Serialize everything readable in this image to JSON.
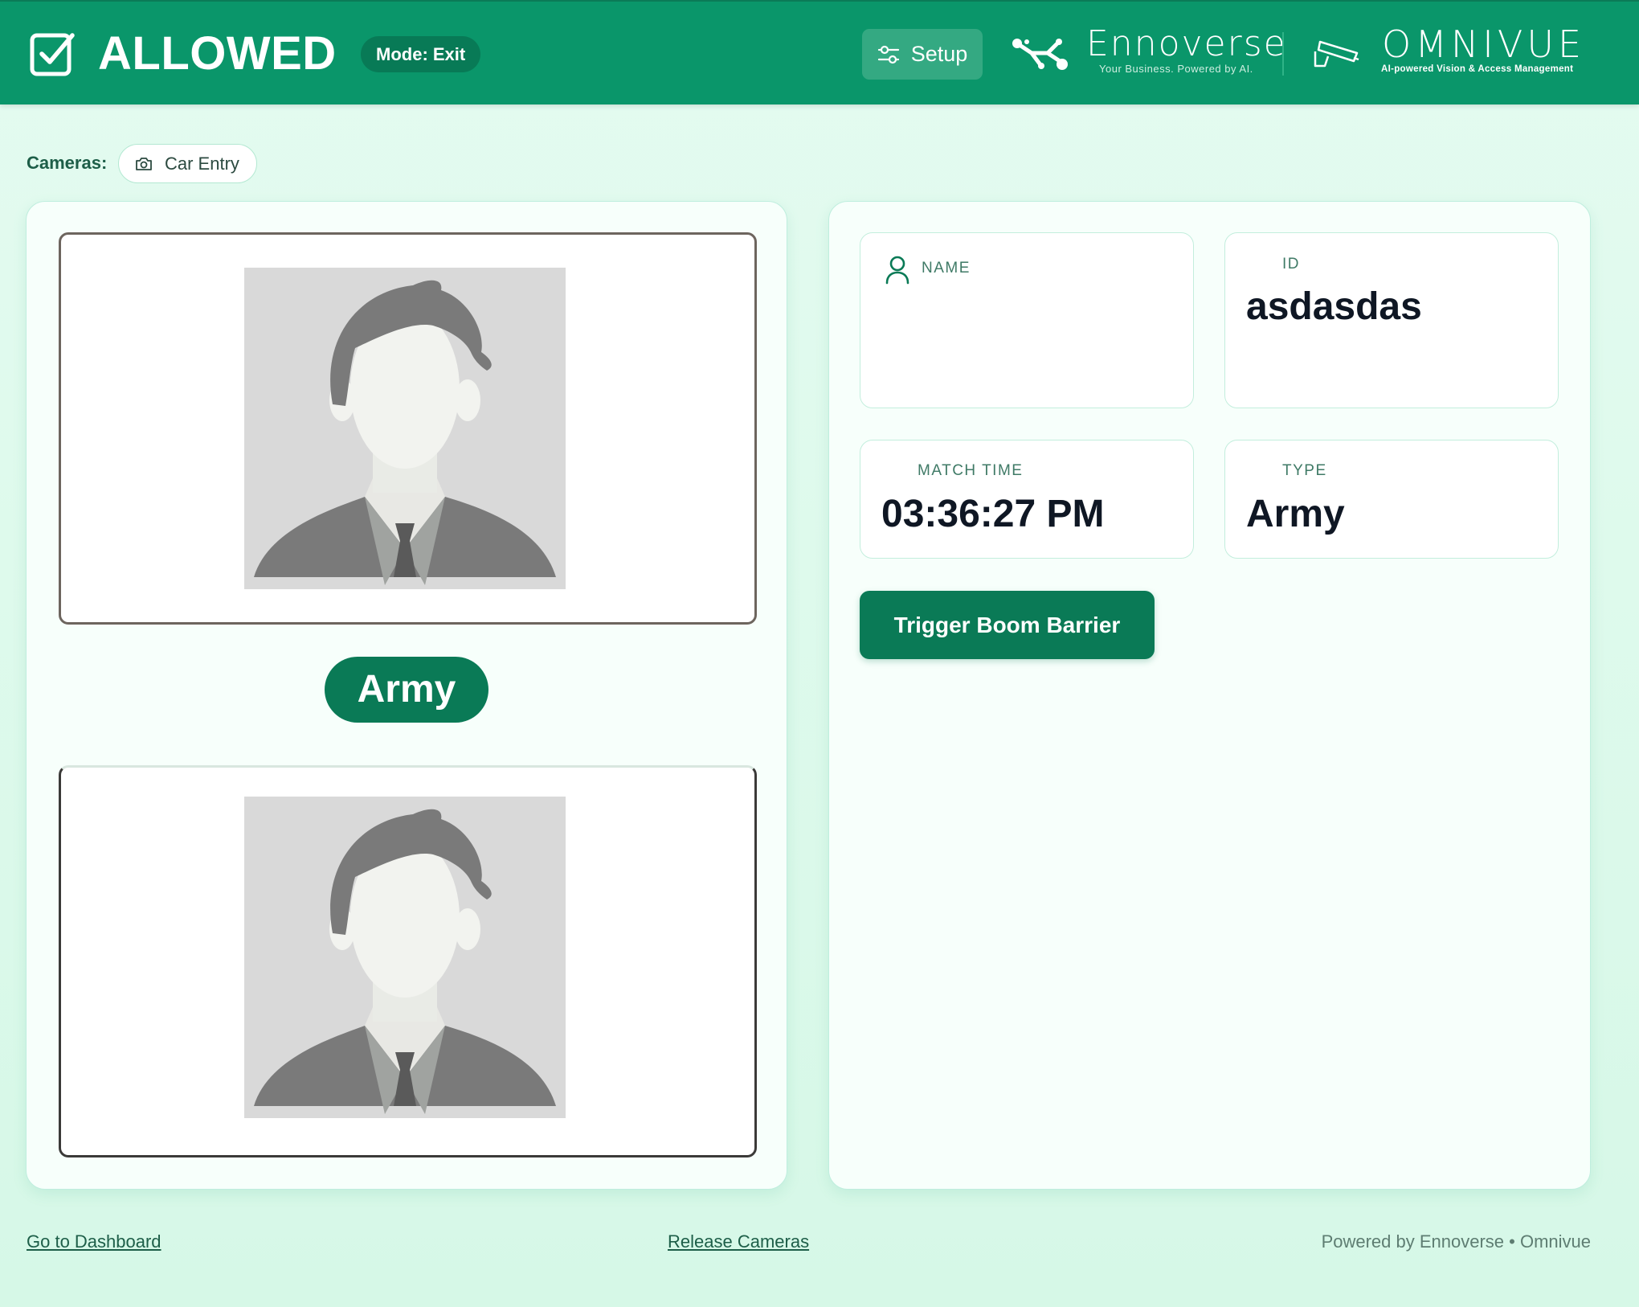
{
  "header": {
    "status": "ALLOWED",
    "mode_badge": "Mode: Exit",
    "setup_label": "Setup",
    "ennoverse": {
      "name": "Ennoverse",
      "tagline": "Your Business. Powered by AI."
    },
    "omnivue": {
      "name": "OMNIVUE",
      "tagline": "AI-powered Vision & Access Management"
    }
  },
  "cameras": {
    "label": "Cameras:",
    "items": [
      {
        "name": "Car Entry",
        "icon": "camera-icon"
      }
    ]
  },
  "left_panel": {
    "type_badge": "Army"
  },
  "details": {
    "name": {
      "label": "NAME",
      "value": ""
    },
    "id": {
      "label": "ID",
      "value": "asdasdas"
    },
    "match_time": {
      "label": "MATCH TIME",
      "value": "03:36:27 PM"
    },
    "type": {
      "label": "TYPE",
      "value": "Army"
    }
  },
  "actions": {
    "trigger_barrier": "Trigger Boom Barrier"
  },
  "footer": {
    "dashboard_link": "Go to Dashboard",
    "release_link": "Release Cameras",
    "powered_by": "Powered by Ennoverse • Omnivue"
  },
  "colors": {
    "header_bg": "#0a966a",
    "accent_dark": "#0a7a56",
    "page_bg": "#e4fbf0"
  }
}
